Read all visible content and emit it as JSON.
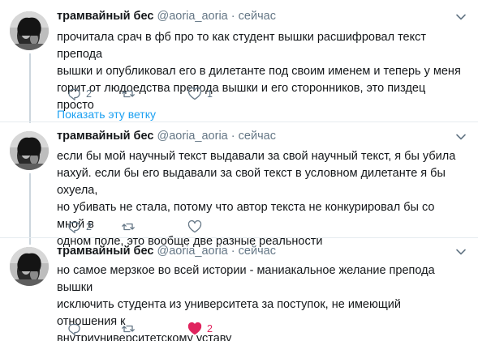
{
  "show_thread": "Показать эту ветку",
  "tweets": [
    {
      "name": "трамвайный бес",
      "handle": "@aoria_aoria",
      "separator": "·",
      "time": "сейчас",
      "lines": [
        "прочитала срач в фб про то как студент вышки расшифровал текст препода",
        "вышки и опубликовал его в дилетанте под своим именем и теперь у меня",
        "горит от людоедства препода вышки и его сторонников, это пиздец просто"
      ],
      "replies": "2",
      "retweets": "",
      "likes": "1",
      "liked": false
    },
    {
      "name": "трамвайный бес",
      "handle": "@aoria_aoria",
      "separator": "·",
      "time": "сейчас",
      "lines": [
        "если бы мой научный текст выдавали за свой научный текст, я бы убила",
        "нахуй. если бы его выдавали за свой текст в условном дилетанте я бы охуела,",
        "но убивать не стала, потому что автор текста не конкурировал бы со мной в",
        "одном поле, это вообще две разные реальности"
      ],
      "replies": "2",
      "retweets": "",
      "likes": "",
      "liked": false
    },
    {
      "name": "трамвайный бес",
      "handle": "@aoria_aoria",
      "separator": "·",
      "time": "сейчас",
      "lines": [
        "но самое мерзкое во всей истории - маниакальное желание препода вышки",
        "исключить студента из университета за поступок, не имеющий отношения к",
        "внутриуниверситетскому уставу"
      ],
      "replies": "",
      "retweets": "",
      "likes": "2",
      "liked": true
    }
  ],
  "colors": {
    "text": "#14171a",
    "secondary": "#657786",
    "link": "#1da1f2",
    "like": "#e0245e",
    "thread_line": "#ccd6dd"
  },
  "icons": [
    "reply-icon",
    "retweet-icon",
    "like-icon",
    "caret-down-icon"
  ]
}
